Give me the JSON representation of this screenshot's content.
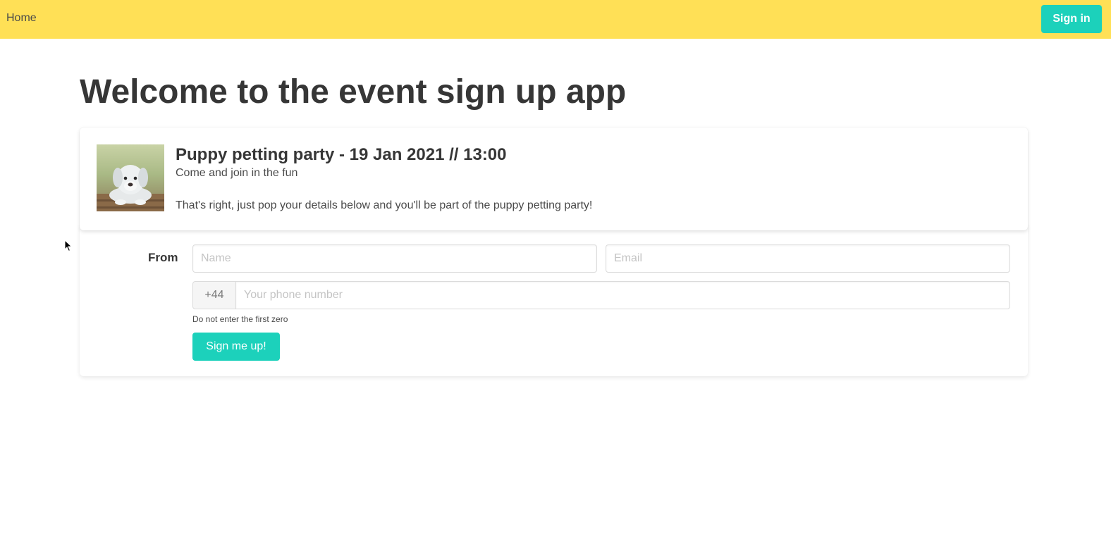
{
  "navbar": {
    "home_label": "Home",
    "signin_label": "Sign in",
    "background_color": "#ffe056",
    "accent_color": "#1cd1bb"
  },
  "main": {
    "title": "Welcome to the event sign up app"
  },
  "event": {
    "title": "Puppy petting party - 19 Jan 2021 // 13:00",
    "subtitle": "Come and join in the fun",
    "description": "That's right, just pop your details below and you'll be part of the puppy petting party!",
    "image_icon": "puppy-photo"
  },
  "form": {
    "from_label": "From",
    "name_placeholder": "Name",
    "name_value": "",
    "email_placeholder": "Email",
    "email_value": "",
    "phone_prefix": "+44",
    "phone_placeholder": "Your phone number",
    "phone_value": "",
    "phone_help": "Do not enter the first zero",
    "submit_label": "Sign me up!"
  }
}
